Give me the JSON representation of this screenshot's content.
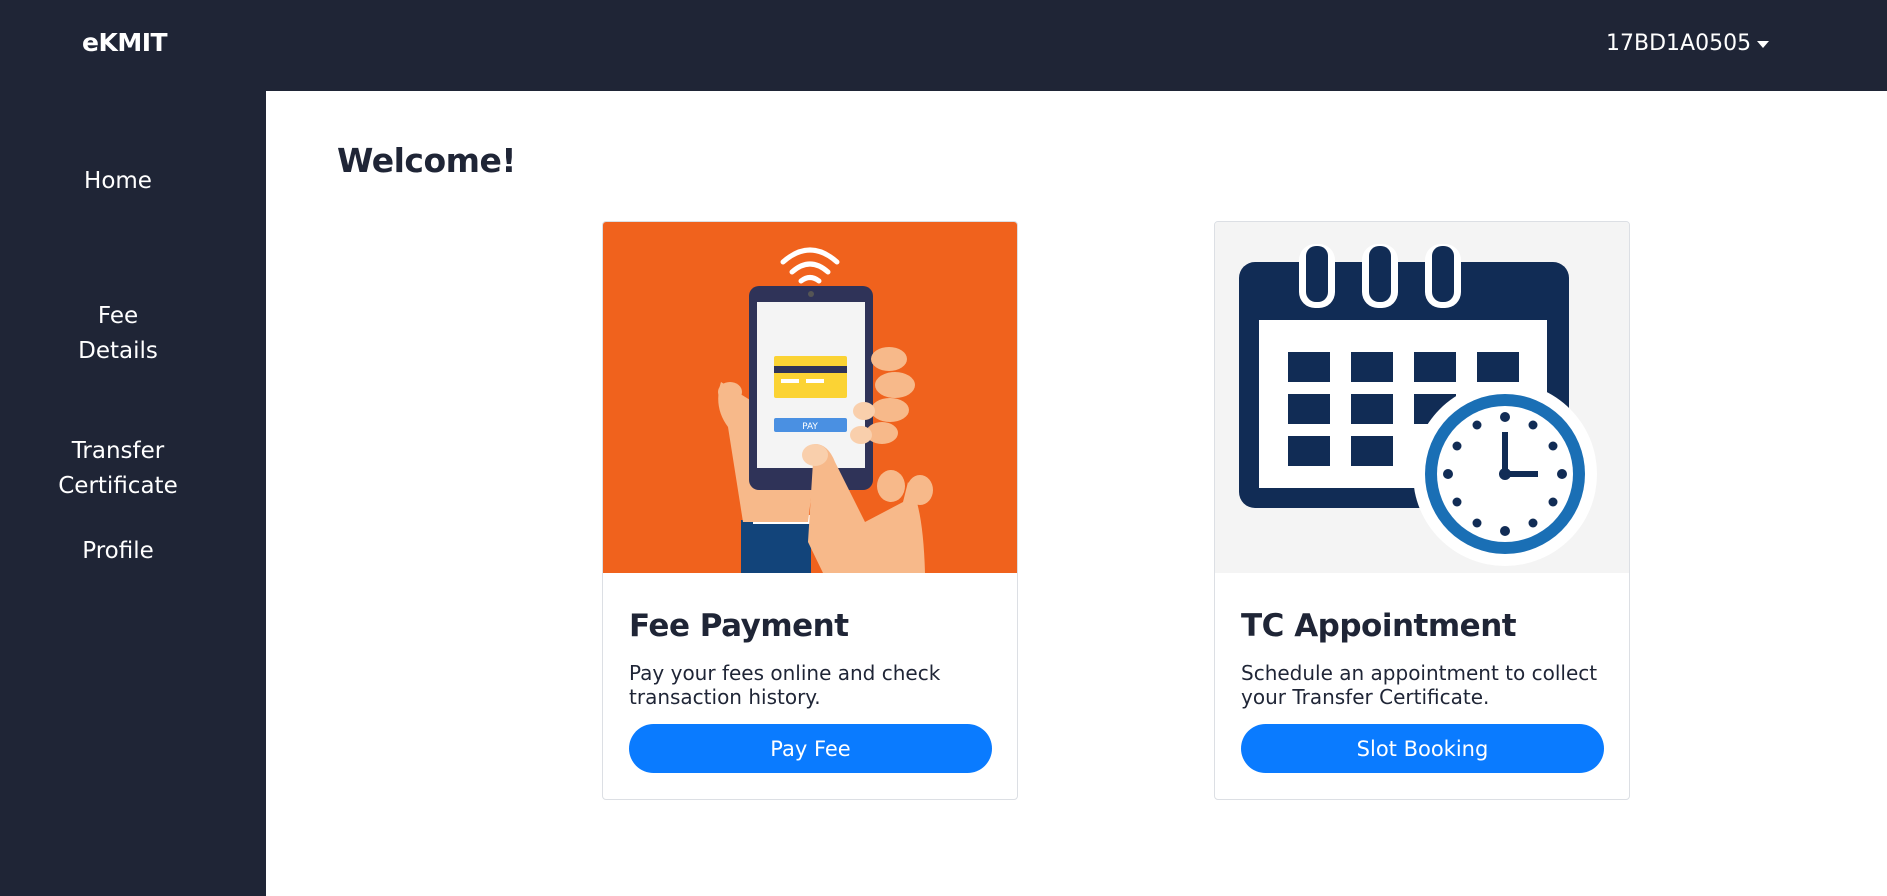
{
  "app": {
    "brand": "eKMIT"
  },
  "header": {
    "user_id": "17BD1A0505"
  },
  "sidebar": {
    "items": [
      {
        "label": "Home"
      },
      {
        "label": "Fee\nDetails"
      },
      {
        "label": "Transfer\nCertificate"
      },
      {
        "label": "Profile"
      }
    ]
  },
  "main": {
    "welcome": "Welcome!",
    "cards": [
      {
        "title": "Fee Payment",
        "description": "Pay your fees online and check transaction history.",
        "button": "Pay Fee",
        "illustration_label": "PAY",
        "icon": "phone-payment-icon"
      },
      {
        "title": "TC Appointment",
        "description": "Schedule an appointment to collect your Transfer Certificate.",
        "button": "Slot Booking",
        "icon": "calendar-clock-icon"
      }
    ]
  },
  "colors": {
    "dark": "#1f2536",
    "accent": "#0a7bff",
    "orange": "#f0621d",
    "navy": "#112c55",
    "clock_blue": "#1a6fb5"
  }
}
